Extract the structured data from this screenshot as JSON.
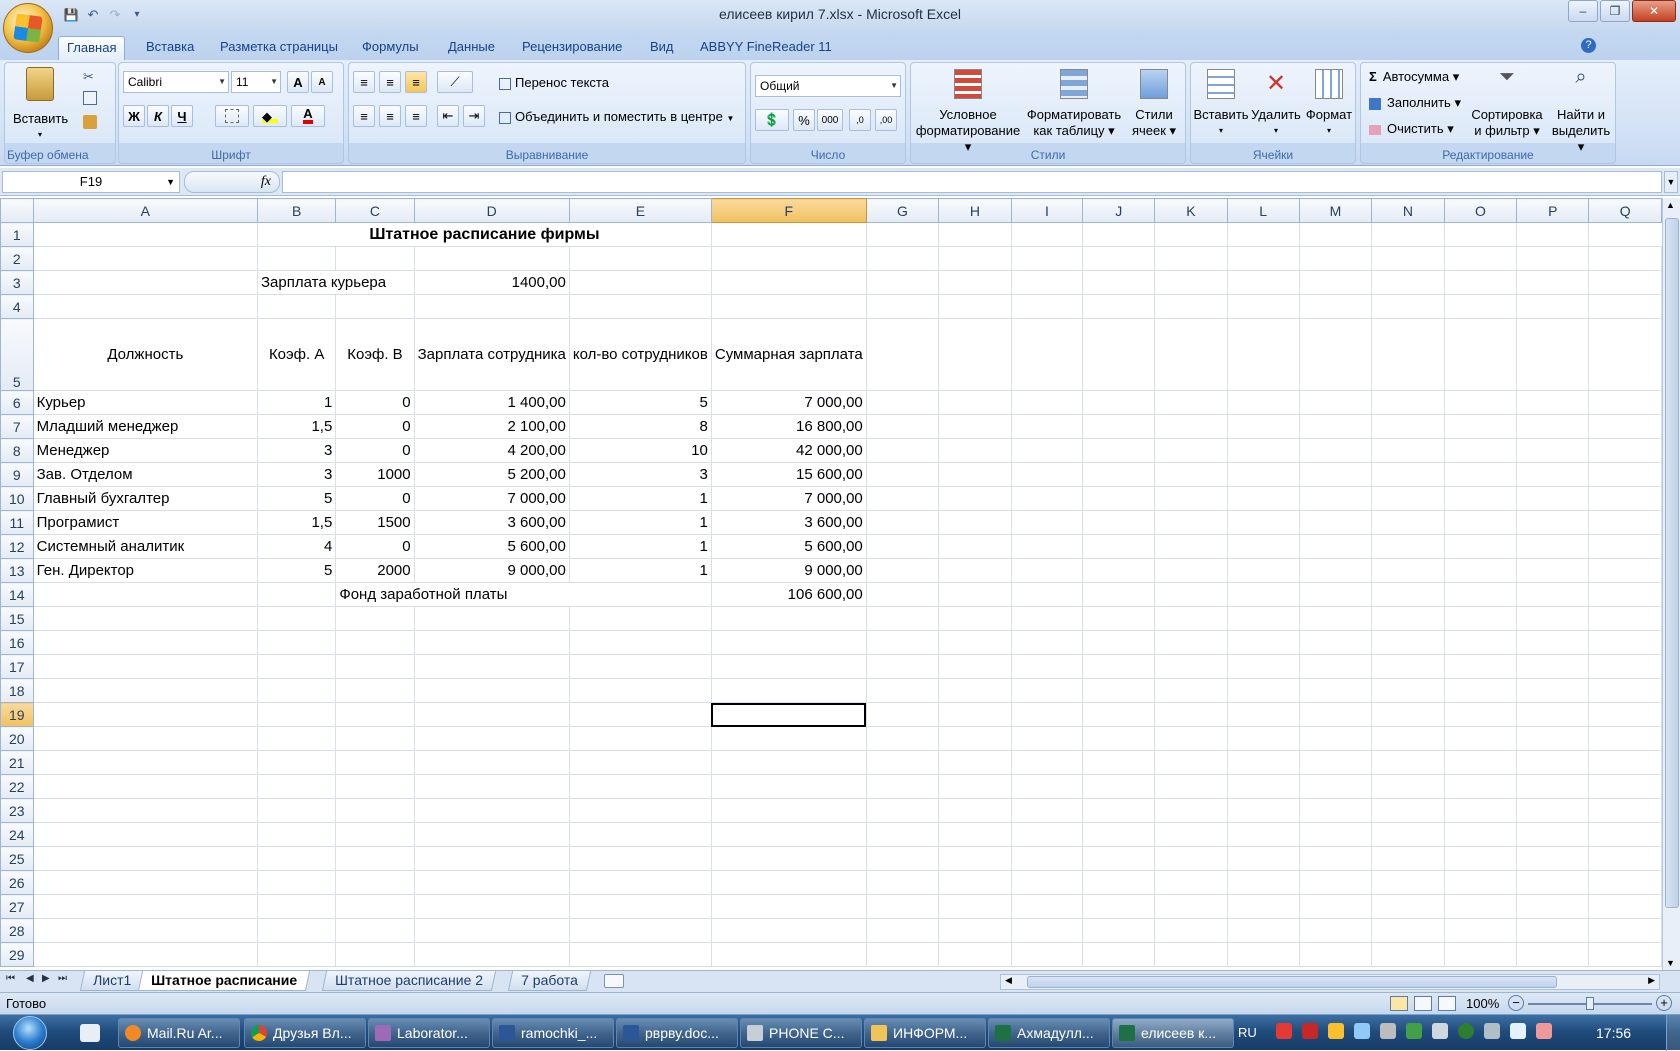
{
  "window": {
    "title": "елисеев кирил 7.xlsx - Microsoft Excel",
    "min": "‒",
    "restore": "❐",
    "close": "✕"
  },
  "qat": {
    "save": "💾",
    "undo": "↶",
    "redo": "↷",
    "customize": "▾"
  },
  "tabs": [
    "Главная",
    "Вставка",
    "Разметка страницы",
    "Формулы",
    "Данные",
    "Рецензирование",
    "Вид",
    "ABBYY FineReader 11"
  ],
  "ribbon": {
    "clipboard": {
      "paste": "Вставить",
      "label": "Буфер обмена"
    },
    "font": {
      "name": "Calibri",
      "size": "11",
      "bold": "Ж",
      "italic": "К",
      "underline": "Ч",
      "grow": "A",
      "shrink": "A",
      "label": "Шрифт",
      "fontcolor": "A"
    },
    "alignment": {
      "wrap": "Перенос текста",
      "merge": "Объединить и поместить в центре",
      "label": "Выравнивание"
    },
    "number": {
      "format": "Общий",
      "percent": "%",
      "thousands": "000",
      "label": "Число"
    },
    "styles": {
      "cond": "Условное",
      "cond2": "форматирование",
      "table": "Форматировать",
      "table2": "как таблицу",
      "cell": "Стили",
      "cell2": "ячеек",
      "label": "Стили"
    },
    "cells": {
      "insert": "Вставить",
      "delete": "Удалить",
      "format": "Формат",
      "label": "Ячейки"
    },
    "editing": {
      "autosum": "Автосумма",
      "fill": "Заполнить",
      "clear": "Очистить",
      "sort": "Сортировка",
      "sort2": "и фильтр",
      "find": "Найти и",
      "find2": "выделить",
      "label": "Редактирование",
      "sigma": "Σ"
    }
  },
  "formula_bar": {
    "name_box": "F19",
    "fx": "fx",
    "value": ""
  },
  "columns": [
    "A",
    "B",
    "C",
    "D",
    "E",
    "F",
    "G",
    "H",
    "I",
    "J",
    "K",
    "L",
    "M",
    "N",
    "O",
    "P",
    "Q"
  ],
  "sheet": {
    "title": "Штатное расписание фирмы",
    "courier_label": "Зарплата курьера",
    "courier_value": "1400,00",
    "headers": {
      "position": "Должность",
      "coef_a": "Коэф. А",
      "coef_b": "Коэф. В",
      "salary": "Зарплата сотрудника",
      "count": "кол-во сотрудников",
      "total": "Суммарная зарплата"
    },
    "rows": [
      {
        "position": "Курьер",
        "a": "1",
        "b": "0",
        "salary": "1 400,00",
        "count": "5",
        "total": "7 000,00"
      },
      {
        "position": "Младший менеджер",
        "a": "1,5",
        "b": "0",
        "salary": "2 100,00",
        "count": "8",
        "total": "16 800,00"
      },
      {
        "position": "Менеджер",
        "a": "3",
        "b": "0",
        "salary": "4 200,00",
        "count": "10",
        "total": "42 000,00"
      },
      {
        "position": "Зав. Отделом",
        "a": "3",
        "b": "1000",
        "salary": "5 200,00",
        "count": "3",
        "total": "15 600,00"
      },
      {
        "position": "Главный бухгалтер",
        "a": "5",
        "b": "0",
        "salary": "7 000,00",
        "count": "1",
        "total": "7 000,00"
      },
      {
        "position": "Програмист",
        "a": "1,5",
        "b": "1500",
        "salary": "3 600,00",
        "count": "1",
        "total": "3 600,00"
      },
      {
        "position": "Системный аналитик",
        "a": "4",
        "b": "0",
        "salary": "5 600,00",
        "count": "1",
        "total": "5 600,00"
      },
      {
        "position": "Ген. Директор",
        "a": "5",
        "b": "2000",
        "salary": "9 000,00",
        "count": "1",
        "total": "9 000,00"
      }
    ],
    "fund_label": "Фонд заработной платы",
    "fund_value": "106 600,00"
  },
  "sheet_tabs": [
    "Лист1",
    "Штатное расписание",
    "Штатное расписание 2",
    "7 работа"
  ],
  "status": {
    "ready": "Готово",
    "zoom": "100%"
  },
  "taskbar": {
    "items": [
      "Mail.Ru Ar...",
      "Друзья Вл...",
      "Laborator...",
      "ramochki_...",
      "рврву.doc...",
      "PHONE C...",
      "ИНФОРМ...",
      "Ахмадулл...",
      "елисеев к..."
    ],
    "lang": "RU",
    "time": "17:56"
  }
}
